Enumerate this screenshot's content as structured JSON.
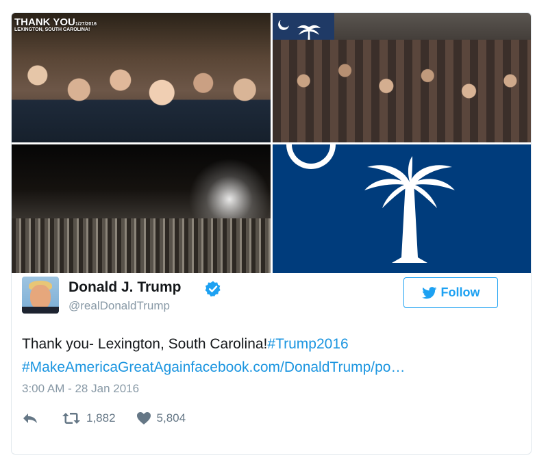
{
  "media": {
    "image1_title": "THANK YOU",
    "image1_date": "1/27/2016",
    "image1_subtitle": "LEXINGTON, SOUTH CAROLINA!"
  },
  "user": {
    "name": "Donald J. Trump",
    "handle": "@realDonaldTrump",
    "verified": true
  },
  "follow_button": {
    "label": "Follow",
    "icon": "twitter-bird-icon"
  },
  "tweet": {
    "line1_text": "Thank you- Lexington, South Carolina!",
    "line1_hashtag": "#Trump2016",
    "line2_hashtag": "#MakeAmericaGreatAgain",
    "line2_link": "facebook.com/DonaldTrump/po…"
  },
  "timestamp": "3:00 AM - 28 Jan 2016",
  "actions": {
    "reply_icon": "reply-icon",
    "retweet_icon": "retweet-icon",
    "retweet_count": "1,882",
    "like_icon": "heart-icon",
    "like_count": "5,804"
  },
  "colors": {
    "link": "#1b95e0",
    "follow": "#1da1f2",
    "muted": "#8899a6",
    "flag_blue": "#003c7c"
  }
}
